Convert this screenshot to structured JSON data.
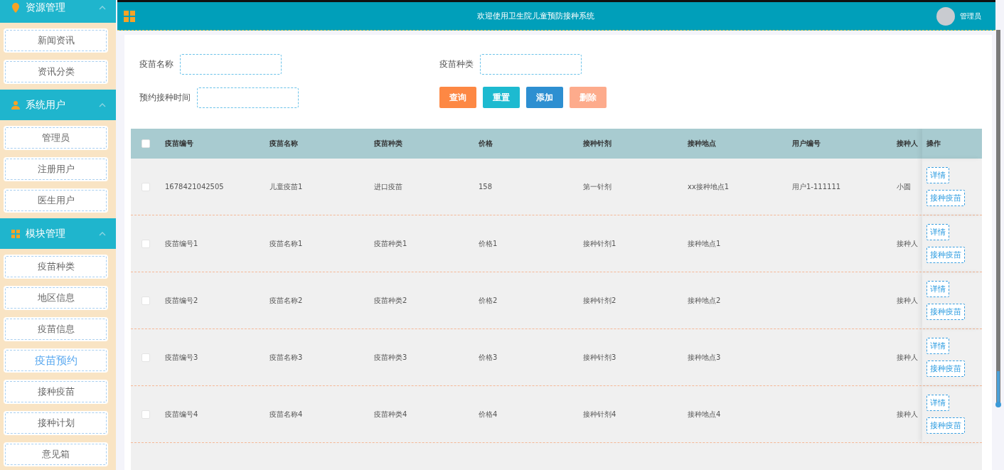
{
  "sidebar": {
    "groups": [
      {
        "title": "资源管理",
        "expanded": true,
        "items": [
          {
            "label": "新闻资讯",
            "selected": false
          },
          {
            "label": "资讯分类",
            "selected": false
          }
        ]
      },
      {
        "title": "系统用户",
        "expanded": true,
        "items": [
          {
            "label": "管理员",
            "selected": false
          },
          {
            "label": "注册用户",
            "selected": false
          },
          {
            "label": "医生用户",
            "selected": false
          }
        ]
      },
      {
        "title": "模块管理",
        "expanded": true,
        "items": [
          {
            "label": "疫苗种类",
            "selected": false
          },
          {
            "label": "地区信息",
            "selected": false
          },
          {
            "label": "疫苗信息",
            "selected": false
          },
          {
            "label": "疫苗预约",
            "selected": true
          },
          {
            "label": "接种疫苗",
            "selected": false
          },
          {
            "label": "接种计划",
            "selected": false
          },
          {
            "label": "意见箱",
            "selected": false
          }
        ]
      }
    ]
  },
  "topbar": {
    "title": "欢迎使用卫生院儿童预防接种系统",
    "user": "管理员"
  },
  "search": {
    "fields": [
      {
        "label": "疫苗名称"
      },
      {
        "label": "疫苗种类"
      },
      {
        "label": "预约接种时间"
      }
    ],
    "buttons": [
      {
        "label": "查询",
        "kind": "search",
        "disabled": false
      },
      {
        "label": "重置",
        "kind": "reset",
        "disabled": false
      },
      {
        "label": "添加",
        "kind": "add",
        "disabled": false
      },
      {
        "label": "删除",
        "kind": "delete",
        "disabled": true
      }
    ]
  },
  "table": {
    "select_all": {
      "checked": false
    },
    "columns": [
      "疫苗编号",
      "疫苗名称",
      "疫苗种类",
      "价格",
      "接种针剂",
      "接种地点",
      "用户编号",
      "接种人",
      "操作"
    ],
    "rows": [
      {
        "checked": false,
        "cells": [
          "1678421042505",
          "儿童疫苗1",
          "进口疫苗",
          "158",
          "第一针剂",
          "xx接种地点1",
          "用户1-111111",
          "小圆"
        ],
        "actions": [
          "详情",
          "接种疫苗"
        ]
      },
      {
        "checked": false,
        "cells": [
          "疫苗编号1",
          "疫苗名称1",
          "疫苗种类1",
          "价格1",
          "接种针剂1",
          "接种地点1",
          "",
          "接种人"
        ],
        "actions": [
          "详情",
          "接种疫苗"
        ]
      },
      {
        "checked": false,
        "cells": [
          "疫苗编号2",
          "疫苗名称2",
          "疫苗种类2",
          "价格2",
          "接种针剂2",
          "接种地点2",
          "",
          "接种人"
        ],
        "actions": [
          "详情",
          "接种疫苗"
        ]
      },
      {
        "checked": false,
        "cells": [
          "疫苗编号3",
          "疫苗名称3",
          "疫苗种类3",
          "价格3",
          "接种针剂3",
          "接种地点3",
          "",
          "接种人"
        ],
        "actions": [
          "详情",
          "接种疫苗"
        ]
      },
      {
        "checked": false,
        "cells": [
          "疫苗编号4",
          "疫苗名称4",
          "疫苗种类4",
          "价格4",
          "接种针剂4",
          "接种地点4",
          "",
          "接种人"
        ],
        "actions": [
          "详情",
          "接种疫苗"
        ]
      }
    ]
  }
}
